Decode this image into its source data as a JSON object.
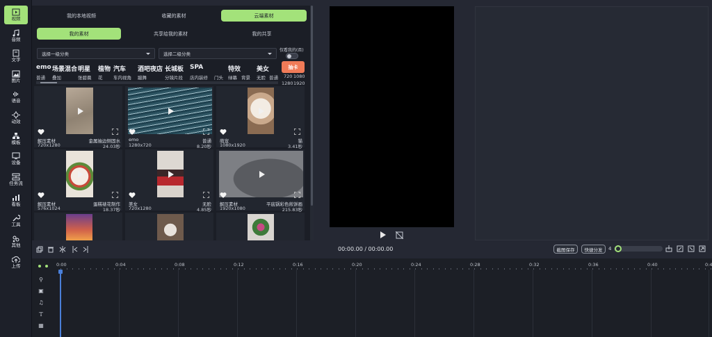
{
  "sidebar": {
    "items": [
      {
        "label": "视频",
        "icon": "video-icon",
        "active": true
      },
      {
        "label": "音频",
        "icon": "music-icon"
      },
      {
        "label": "文字",
        "icon": "text-icon"
      },
      {
        "label": "图片",
        "icon": "image-icon"
      },
      {
        "label": "语音",
        "icon": "voice-icon"
      },
      {
        "label": "动效",
        "icon": "effects-icon"
      },
      {
        "label": "模板",
        "icon": "template-icon"
      },
      {
        "label": "设备",
        "icon": "device-icon"
      },
      {
        "label": "任务流",
        "icon": "workflow-icon"
      },
      {
        "label": "看板",
        "icon": "dashboard-icon"
      },
      {
        "label": "工具",
        "icon": "tools-icon"
      },
      {
        "label": "其他",
        "icon": "other-icon"
      },
      {
        "label": "上传",
        "icon": "upload-icon"
      }
    ]
  },
  "library": {
    "top_tabs": [
      "我的本地视频",
      "收藏的素材",
      "云端素材"
    ],
    "active_top_tab": 2,
    "sub_tabs": [
      "我的素材",
      "共享给我的素材",
      "我的共享"
    ],
    "active_sub_tab": 0,
    "select1": "选择一级分类",
    "select2": "选择二级分类",
    "only_mine_label": "仅看我的(否)",
    "draw_card_button": "抽卡",
    "categories": [
      "emo",
      "场景混合",
      "明星",
      "植物",
      "汽车",
      "酒吧夜店",
      "长城板",
      "SPA",
      "特效",
      "美女"
    ],
    "subcategories": [
      "普通",
      "叠加",
      "张碧晨",
      "花",
      "车内视角",
      "蹦舞",
      "分镜片段",
      "店内装修",
      "门头",
      "绿幕",
      "背景",
      "无脸",
      "普通"
    ],
    "resolutions": [
      "720",
      "1080",
      "1280",
      "1920"
    ],
    "cards": [
      {
        "left1": "解压素材",
        "left2": "720x1280",
        "right1": "金属抽边侧固水",
        "right2": "24.03秒"
      },
      {
        "left1": "emo",
        "left2": "1280x720",
        "right1": "普通",
        "right2": "8.20秒"
      },
      {
        "left1": "萌宠",
        "left2": "1080x1920",
        "right1": "猫",
        "right2": "3.41秒"
      },
      {
        "left1": "解压素材",
        "left2": "576x1024",
        "right1": "蛋糕裱花制作",
        "right2": "18.37秒"
      },
      {
        "left1": "美女",
        "left2": "720x1280",
        "right1": "无脸",
        "right2": "4.85秒"
      },
      {
        "left1": "解压素材",
        "left2": "1920x1080",
        "right1": "平底锅彩色煎饼画",
        "right2": "215.83秒"
      },
      {
        "left1": "",
        "left2": "",
        "right1": "",
        "right2": ""
      },
      {
        "left1": "",
        "left2": "",
        "right1": "",
        "right2": ""
      },
      {
        "left1": "",
        "left2": "",
        "right1": "",
        "right2": ""
      }
    ]
  },
  "player": {
    "time": "00:00.00 / 00:00.00"
  },
  "toolbar": {
    "save_cover": "截图保存",
    "quick_share": "快捷分发",
    "zoom_value": "4"
  },
  "timeline": {
    "ticks": [
      "0:00",
      "0:04",
      "0:08",
      "0:12",
      "0:16",
      "0:20",
      "0:24",
      "0:28",
      "0:32",
      "0:36",
      "0:40",
      "0:4"
    ]
  }
}
